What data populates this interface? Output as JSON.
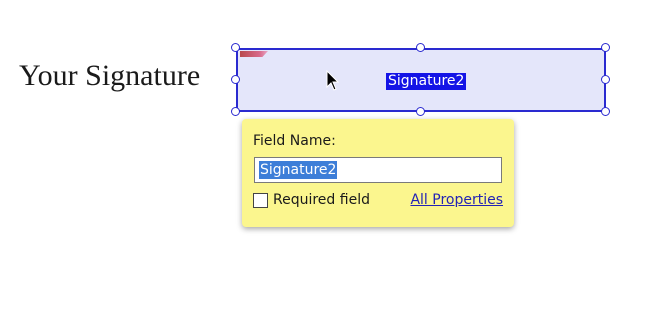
{
  "document": {
    "label": "Your Signature"
  },
  "signature_field": {
    "value": "Signature2",
    "fill_color": "#e4e6fa",
    "border_color": "#2a2ad0",
    "selected_text_color": "#1414e6"
  },
  "popup": {
    "field_name_label": "Field Name:",
    "field_name_value": "Signature2",
    "required_label": "Required field",
    "required_checked": false,
    "all_properties_link": "All Properties",
    "background_color": "#fbf68e"
  },
  "icons": {
    "cursor": "mouse-pointer-icon",
    "field_tag": "field-type-tag-icon"
  }
}
